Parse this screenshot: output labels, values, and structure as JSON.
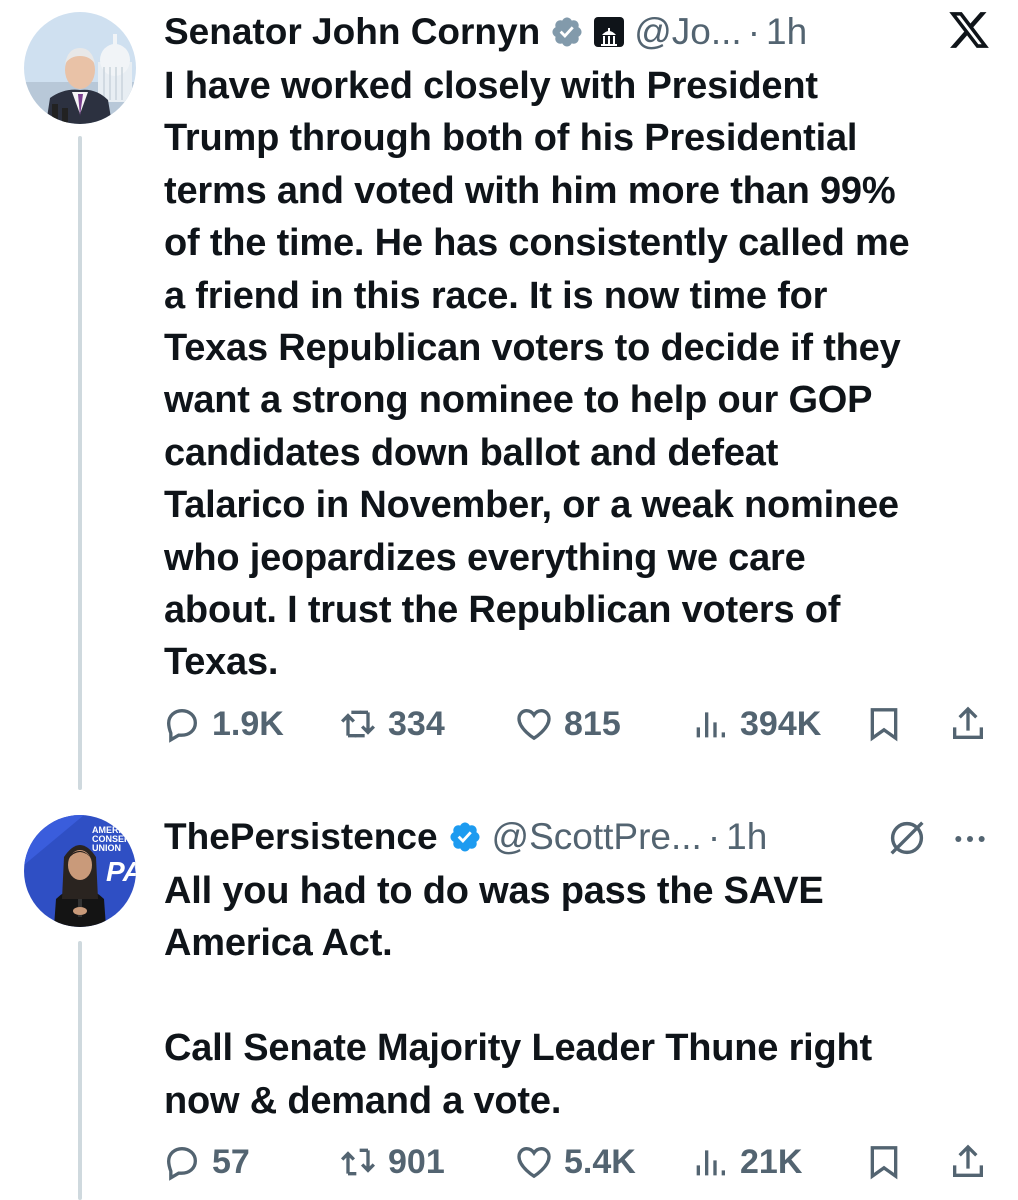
{
  "tweets": [
    {
      "name": "Senator John Cornyn",
      "handle": "@Jo...",
      "separator": "·",
      "time": "1h",
      "text": "I have worked closely with President\nTrump through both of his Presidential\nterms and voted with him more than 99%\nof the time. He has consistently called me\na friend in this race. It is now time for\nTexas Republican voters to decide if they\nwant a strong nominee to help our GOP\ncandidates down ballot and defeat\nTalarico in November, or a weak nominee\nwho jeopardizes everything we care\nabout. I trust the Republican voters of\nTexas.",
      "replies": "1.9K",
      "reposts": "334",
      "likes": "815",
      "views": "394K"
    },
    {
      "name": "ThePersistence",
      "handle": "@ScottPre...",
      "separator": "·",
      "time": "1h",
      "avatar_badge": "AMERICAN CONSERVATIVE UNION",
      "text": "All you had to do was pass the SAVE\nAmerica Act.\n\nCall Senate Majority Leader Thune right\nnow & demand a vote.",
      "replies": "57",
      "reposts": "901",
      "likes": "5.4K",
      "views": "21K"
    }
  ],
  "colors": {
    "text": "#0f1419",
    "secondary": "#536471",
    "verified": "#1d9bf0",
    "thread_line": "#cfd9de"
  },
  "icons": [
    "verified-badge-icon",
    "government-affiliation-icon",
    "x-logo-icon",
    "grok-icon",
    "more-icon",
    "reply-icon",
    "repost-icon",
    "like-icon",
    "views-icon",
    "bookmark-icon",
    "share-icon"
  ]
}
